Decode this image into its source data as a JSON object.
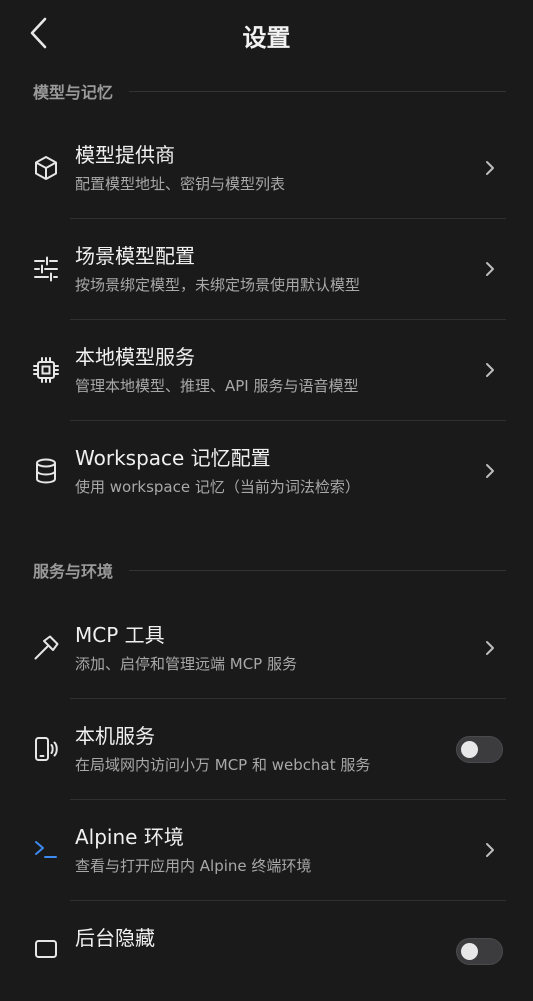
{
  "header": {
    "title": "设置",
    "back_icon": "chevron-left-icon"
  },
  "sections": [
    {
      "label": "模型与记忆",
      "items": [
        {
          "title": "模型提供商",
          "desc": "配置模型地址、密钥与模型列表",
          "icon": "cube-icon",
          "control": "chevron"
        },
        {
          "title": "场景模型配置",
          "desc": "按场景绑定模型，未绑定场景使用默认模型",
          "icon": "sliders-icon",
          "control": "chevron"
        },
        {
          "title": "本地模型服务",
          "desc": "管理本地模型、推理、API 服务与语音模型",
          "icon": "chip-icon",
          "control": "chevron"
        },
        {
          "title": "Workspace 记忆配置",
          "desc": "使用 workspace 记忆（当前为词法检索）",
          "icon": "database-icon",
          "control": "chevron"
        }
      ]
    },
    {
      "label": "服务与环境",
      "items": [
        {
          "title": "MCP 工具",
          "desc": "添加、启停和管理远端 MCP 服务",
          "icon": "hammer-icon",
          "control": "chevron"
        },
        {
          "title": "本机服务",
          "desc": "在局域网内访问小万 MCP 和 webchat 服务",
          "icon": "phone-broadcast-icon",
          "control": "toggle",
          "toggle_on": false
        },
        {
          "title": "Alpine 环境",
          "desc": "查看与打开应用内 Alpine 终端环境",
          "icon": "terminal-icon",
          "control": "chevron"
        },
        {
          "title": "后台隐藏",
          "desc": "",
          "icon": "hide-icon",
          "control": "toggle",
          "toggle_on": false
        }
      ]
    }
  ],
  "colors": {
    "background": "#1a1a1b",
    "accent": "#3d8bf0",
    "muted_text": "#a8a8a8"
  }
}
